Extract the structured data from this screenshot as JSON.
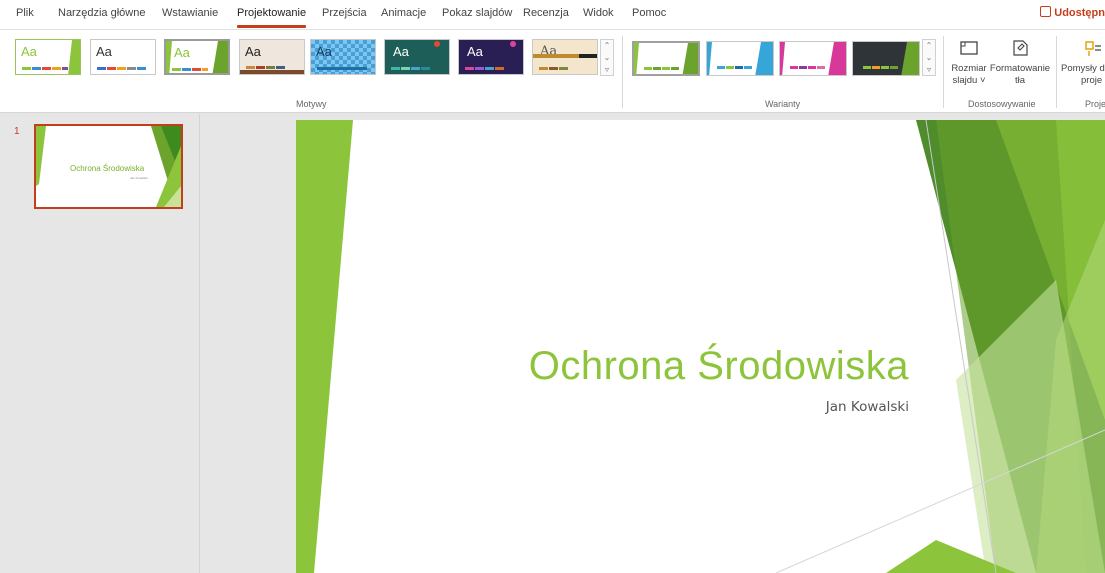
{
  "tabs": [
    "Plik",
    "Narzędzia główne",
    "Wstawianie",
    "Projektowanie",
    "Przejścia",
    "Animacje",
    "Pokaz slajdów",
    "Recenzja",
    "Widok",
    "Pomoc"
  ],
  "active_tab": "Projektowanie",
  "share_label": "Udostępn",
  "ribbon": {
    "themes_group": "Motywy",
    "variants_group": "Warianty",
    "customize_group": "Dostosowywanie",
    "design_group": "Projek",
    "theme_sample": "Aa",
    "slide_size_line1": "Rozmiar",
    "slide_size_line2": "slajdu ˅",
    "format_bg_line1": "Formatowanie",
    "format_bg_line2": "tła",
    "design_ideas_line1": "Pomysły d",
    "design_ideas_line2": "proje"
  },
  "slides": {
    "count_label": "1",
    "thumb_title": "Ochrona Środowiska",
    "thumb_subtitle": "Jan Kowalski"
  },
  "slide": {
    "title": "Ochrona Środowiska",
    "subtitle": "Jan Kowalski"
  },
  "colors": {
    "accent": "#c43e1c",
    "title_green": "#8cc43c"
  },
  "icons": [
    "share-icon",
    "slide-size-icon",
    "format-background-icon",
    "design-ideas-icon",
    "scroll-up-icon",
    "scroll-down-icon",
    "more-icon"
  ]
}
